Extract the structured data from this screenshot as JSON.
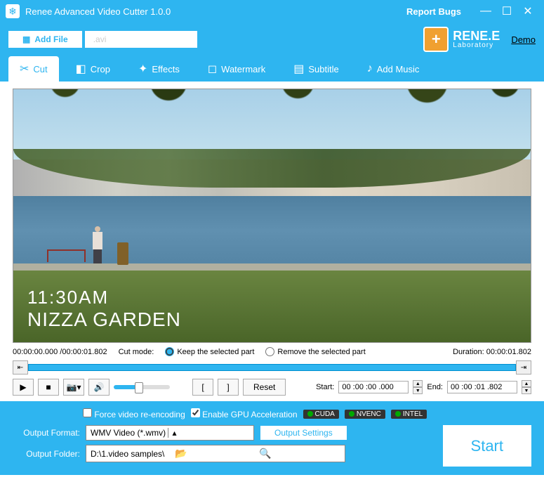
{
  "titlebar": {
    "title": "Renee Advanced Video Cutter 1.0.0",
    "report": "Report Bugs"
  },
  "subheader": {
    "addfile": "Add File",
    "filename": ".avi",
    "logo_main": "RENE.E",
    "logo_sub": "Laboratory",
    "demo": "Demo"
  },
  "tabs": {
    "cut": "Cut",
    "crop": "Crop",
    "effects": "Effects",
    "watermark": "Watermark",
    "subtitle": "Subtitle",
    "addmusic": "Add Music"
  },
  "preview": {
    "time_overlay": "11:30AM",
    "place_overlay": "NIZZA GARDEN"
  },
  "inforow": {
    "position": "00:00:00.000 /00:00:01.802",
    "cutmode_label": "Cut mode:",
    "keep": "Keep the selected part",
    "remove": "Remove the selected part",
    "duration": "Duration: 00:00:01.802"
  },
  "controls": {
    "reset": "Reset",
    "start_label": "Start:",
    "start_value": "00 :00 :00 .000",
    "end_label": "End:",
    "end_value": "00 :00 :01 .802"
  },
  "footer": {
    "force_reencode": "Force video re-encoding",
    "gpu_accel": "Enable GPU Acceleration",
    "badges": {
      "cuda": "CUDA",
      "nvenc": "NVENC",
      "intel": "INTEL"
    },
    "format_label": "Output Format:",
    "format_value": "WMV Video (*.wmv)",
    "output_settings": "Output Settings",
    "folder_label": "Output Folder:",
    "folder_value": "D:\\1.video samples\\",
    "start": "Start"
  }
}
